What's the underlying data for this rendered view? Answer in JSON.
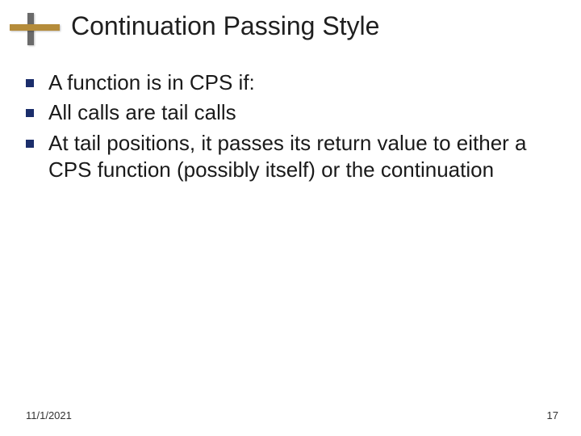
{
  "title": "Continuation Passing Style",
  "bullets": [
    "A function is in CPS if:",
    "All calls are tail calls",
    "At tail positions, it passes its return value to either a CPS function (possibly itself) or the continuation"
  ],
  "footer": {
    "date": "11/1/2021",
    "page": "17"
  },
  "colors": {
    "accent_h": "#b58c3a",
    "accent_v": "#6a6a6a",
    "bullet": "#1b2e6b"
  }
}
